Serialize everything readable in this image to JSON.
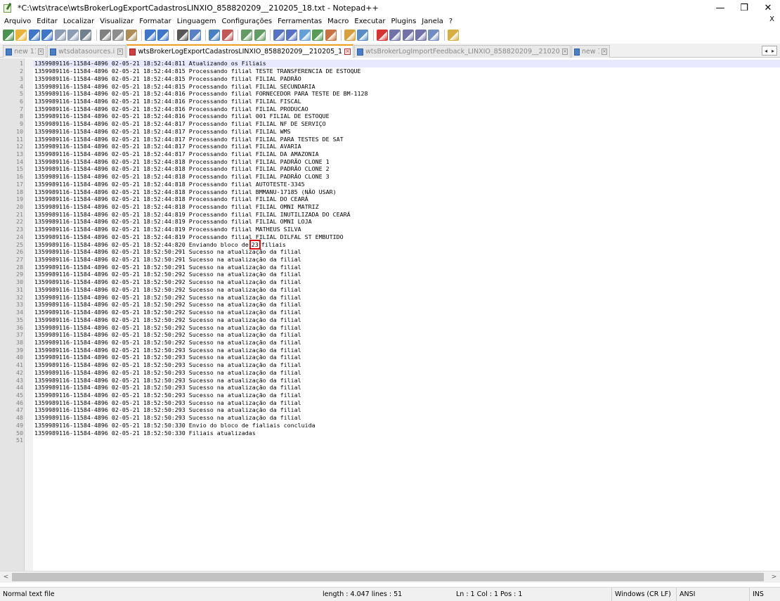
{
  "window": {
    "title": "*C:\\wts\\trace\\wtsBrokerLogExportCadastrosLINXIO_858820209__210205_18.txt - Notepad++",
    "minimize_glyph": "—",
    "maximize_glyph": "❐",
    "close_glyph": "✕"
  },
  "menu": {
    "items": [
      "Arquivo",
      "Editar",
      "Localizar",
      "Visualizar",
      "Formatar",
      "Linguagem",
      "Configurações",
      "Ferramentas",
      "Macro",
      "Executar",
      "Plugins",
      "Janela",
      "?"
    ],
    "close_label": "X"
  },
  "toolbar": {
    "icons": [
      "new-file-icon",
      "open-file-icon",
      "save-icon",
      "save-all-icon",
      "close-icon",
      "close-all-icon",
      "print-icon",
      "cut-icon",
      "copy-icon",
      "paste-icon",
      "undo-icon",
      "redo-icon",
      "find-icon",
      "replace-icon",
      "zoom-in-icon",
      "zoom-out-icon",
      "sync-vertical-icon",
      "sync-horizontal-icon",
      "word-wrap-icon",
      "show-all-chars-icon",
      "indent-guide-icon",
      "doc-map-icon",
      "function-list-icon",
      "folder-workspace-icon",
      "monitoring-icon",
      "record-macro-icon",
      "stop-macro-icon",
      "play-macro-icon",
      "run-macro-multiple-icon",
      "save-macro-icon",
      "spellcheck-icon"
    ],
    "colors": [
      "#2e7d32",
      "#e6a817",
      "#1f5fbf",
      "#1f5fbf",
      "#7a8ea8",
      "#7a8ea8",
      "#5a6a7a",
      "#6a6a6a",
      "#7a7a7a",
      "#a07a3a",
      "#1f5fbf",
      "#1f5fbf",
      "#3a3a3a",
      "#3a6ab8",
      "#2a6ab8",
      "#b83a3a",
      "#4a8a4a",
      "#4a8a4a",
      "#3a5ab8",
      "#3a5ab8",
      "#4a90d0",
      "#3a8a3a",
      "#c05a20",
      "#d09020",
      "#3a7ab8",
      "#d01010",
      "#5a5a9a",
      "#5a5a9a",
      "#5a5a9a",
      "#5a7ab8",
      "#d0a020"
    ]
  },
  "tabs": [
    {
      "label": "new 11",
      "active": false,
      "modified": false
    },
    {
      "label": "wtsdatasources.ini",
      "active": false,
      "modified": false
    },
    {
      "label": "wtsBrokerLogExportCadastrosLINXIO_858820209__210205_18.txt",
      "active": true,
      "modified": true
    },
    {
      "label": "wtsBrokerLogImportFeedback_LINXIO_858820209__210205_18.txt",
      "active": false,
      "modified": false
    },
    {
      "label": "new 10",
      "active": false,
      "modified": false
    }
  ],
  "tab_arrows": {
    "left": "◂",
    "right": "▸"
  },
  "editor": {
    "current_line": 1,
    "highlight": {
      "line": 25,
      "text": "23"
    },
    "lines": [
      "1359989116-11584-4896 02-05-21 18:52:44:811 Atualizando os Filiais",
      "1359989116-11584-4896 02-05-21 18:52:44:815 Processando filial TESTE TRANSFERENCIA DE ESTOQUE",
      "1359989116-11584-4896 02-05-21 18:52:44:815 Processando filial FILIAL PADRÃO",
      "1359989116-11584-4896 02-05-21 18:52:44:815 Processando filial FILIAL SECUNDARIA",
      "1359989116-11584-4896 02-05-21 18:52:44:816 Processando filial FORNECEDOR PARA TESTE DE BM-1128",
      "1359989116-11584-4896 02-05-21 18:52:44:816 Processando filial FILIAL FISCAL",
      "1359989116-11584-4896 02-05-21 18:52:44:816 Processando filial FILIAL PRODUCAO",
      "1359989116-11584-4896 02-05-21 18:52:44:816 Processando filial 001 FILIAL DE ESTOQUE",
      "1359989116-11584-4896 02-05-21 18:52:44:817 Processando filial FILIAL NF DE SERVIÇO",
      "1359989116-11584-4896 02-05-21 18:52:44:817 Processando filial FILIAL WMS",
      "1359989116-11584-4896 02-05-21 18:52:44:817 Processando filial FILIAL PARA TESTES DE SAT",
      "1359989116-11584-4896 02-05-21 18:52:44:817 Processando filial FILIAL AVARIA",
      "1359989116-11584-4896 02-05-21 18:52:44:817 Processando filial FILIAL DA AMAZONIA",
      "1359989116-11584-4896 02-05-21 18:52:44:818 Processando filial FILIAL PADRÃO CLONE 1",
      "1359989116-11584-4896 02-05-21 18:52:44:818 Processando filial FILIAL PADRÃO CLONE 2",
      "1359989116-11584-4896 02-05-21 18:52:44:818 Processando filial FILIAL PADRÃO CLONE 3",
      "1359989116-11584-4896 02-05-21 18:52:44:818 Processando filial AUTOTESTE-3345",
      "1359989116-11584-4896 02-05-21 18:52:44:818 Processando filial BMMANU-17185 (NÃO USAR)",
      "1359989116-11584-4896 02-05-21 18:52:44:818 Processando filial FILIAL DO CEARÁ",
      "1359989116-11584-4896 02-05-21 18:52:44:818 Processando filial FILIAL OMNI MATRIZ",
      "1359989116-11584-4896 02-05-21 18:52:44:819 Processando filial FILIAL INUTILIZADA DO CEARÁ",
      "1359989116-11584-4896 02-05-21 18:52:44:819 Processando filial FILIAL OMNI LOJA",
      "1359989116-11584-4896 02-05-21 18:52:44:819 Processando filial MATHEUS SILVA",
      "1359989116-11584-4896 02-05-21 18:52:44:819 Processando filial FILIAL DILFAL ST EMBUTIDO",
      "1359989116-11584-4896 02-05-21 18:52:44:820 Enviando bloco de 23 filiais",
      "1359989116-11584-4896 02-05-21 18:52:50:291 Sucesso na atualização da filial",
      "1359989116-11584-4896 02-05-21 18:52:50:291 Sucesso na atualização da filial",
      "1359989116-11584-4896 02-05-21 18:52:50:291 Sucesso na atualização da filial",
      "1359989116-11584-4896 02-05-21 18:52:50:292 Sucesso na atualização da filial",
      "1359989116-11584-4896 02-05-21 18:52:50:292 Sucesso na atualização da filial",
      "1359989116-11584-4896 02-05-21 18:52:50:292 Sucesso na atualização da filial",
      "1359989116-11584-4896 02-05-21 18:52:50:292 Sucesso na atualização da filial",
      "1359989116-11584-4896 02-05-21 18:52:50:292 Sucesso na atualização da filial",
      "1359989116-11584-4896 02-05-21 18:52:50:292 Sucesso na atualização da filial",
      "1359989116-11584-4896 02-05-21 18:52:50:292 Sucesso na atualização da filial",
      "1359989116-11584-4896 02-05-21 18:52:50:292 Sucesso na atualização da filial",
      "1359989116-11584-4896 02-05-21 18:52:50:292 Sucesso na atualização da filial",
      "1359989116-11584-4896 02-05-21 18:52:50:292 Sucesso na atualização da filial",
      "1359989116-11584-4896 02-05-21 18:52:50:293 Sucesso na atualização da filial",
      "1359989116-11584-4896 02-05-21 18:52:50:293 Sucesso na atualização da filial",
      "1359989116-11584-4896 02-05-21 18:52:50:293 Sucesso na atualização da filial",
      "1359989116-11584-4896 02-05-21 18:52:50:293 Sucesso na atualização da filial",
      "1359989116-11584-4896 02-05-21 18:52:50:293 Sucesso na atualização da filial",
      "1359989116-11584-4896 02-05-21 18:52:50:293 Sucesso na atualização da filial",
      "1359989116-11584-4896 02-05-21 18:52:50:293 Sucesso na atualização da filial",
      "1359989116-11584-4896 02-05-21 18:52:50:293 Sucesso na atualização da filial",
      "1359989116-11584-4896 02-05-21 18:52:50:293 Sucesso na atualização da filial",
      "1359989116-11584-4896 02-05-21 18:52:50:293 Sucesso na atualização da filial",
      "1359989116-11584-4896 02-05-21 18:52:50:330 Envio do bloco de fialiais concluida",
      "1359989116-11584-4896 02-05-21 18:52:50:330 Filiais atualizadas",
      ""
    ]
  },
  "scrollbar": {
    "left_arrow": "<",
    "right_arrow": ">"
  },
  "status": {
    "file_type": "Normal text file",
    "length": "length : 4.047    lines : 51",
    "position": "Ln : 1    Col : 1    Pos : 1",
    "eol": "Windows (CR LF)",
    "encoding": "ANSI",
    "mode": "INS"
  }
}
